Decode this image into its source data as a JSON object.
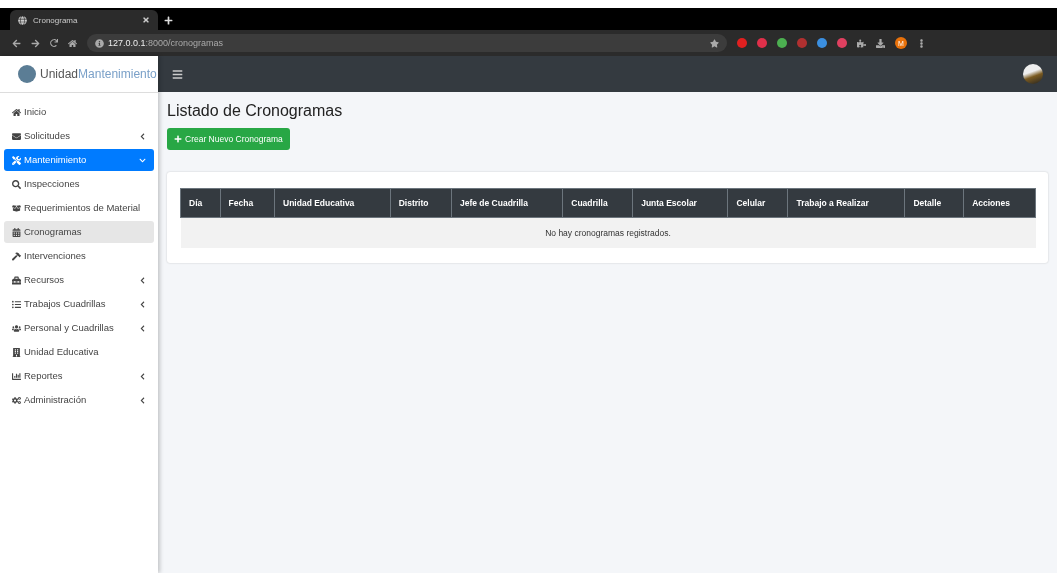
{
  "browser": {
    "tab_title": "Cronograma",
    "url_host": "127.0.0.1",
    "url_path": ":8000/cronogramas",
    "profile_initial": "M"
  },
  "brand": {
    "name_bold": "Unidad",
    "name_light": "Mantenimiento"
  },
  "sidebar": {
    "items": [
      {
        "label": "Inicio",
        "selected": false
      },
      {
        "label": "Solicitudes",
        "selected": false,
        "expanded": false
      },
      {
        "label": "Mantenimiento",
        "selected": true,
        "expanded": true,
        "children": [
          {
            "label": "Inspecciones",
            "selected": false
          },
          {
            "label": "Requerimientos de Material",
            "selected": false
          },
          {
            "label": "Cronogramas",
            "selected": true
          },
          {
            "label": "Intervenciones",
            "selected": false
          }
        ]
      },
      {
        "label": "Recursos",
        "selected": false,
        "expanded": false
      },
      {
        "label": "Trabajos Cuadrillas",
        "selected": false,
        "expanded": false
      },
      {
        "label": "Personal y Cuadrillas",
        "selected": false,
        "expanded": false
      },
      {
        "label": "Unidad Educativa",
        "selected": false
      },
      {
        "label": "Reportes",
        "selected": false,
        "expanded": false
      },
      {
        "label": "Administración",
        "selected": false,
        "expanded": false
      }
    ]
  },
  "page": {
    "title": "Listado de Cronogramas",
    "create_button": "Crear Nuevo Cronograma"
  },
  "table": {
    "columns": [
      "Día",
      "Fecha",
      "Unidad Educativa",
      "Distrito",
      "Jefe de Cuadrilla",
      "Cuadrilla",
      "Junta Escolar",
      "Celular",
      "Trabajo a Realizar",
      "Detalle",
      "Acciones"
    ],
    "empty_message": "No hay cronogramas registrados."
  }
}
